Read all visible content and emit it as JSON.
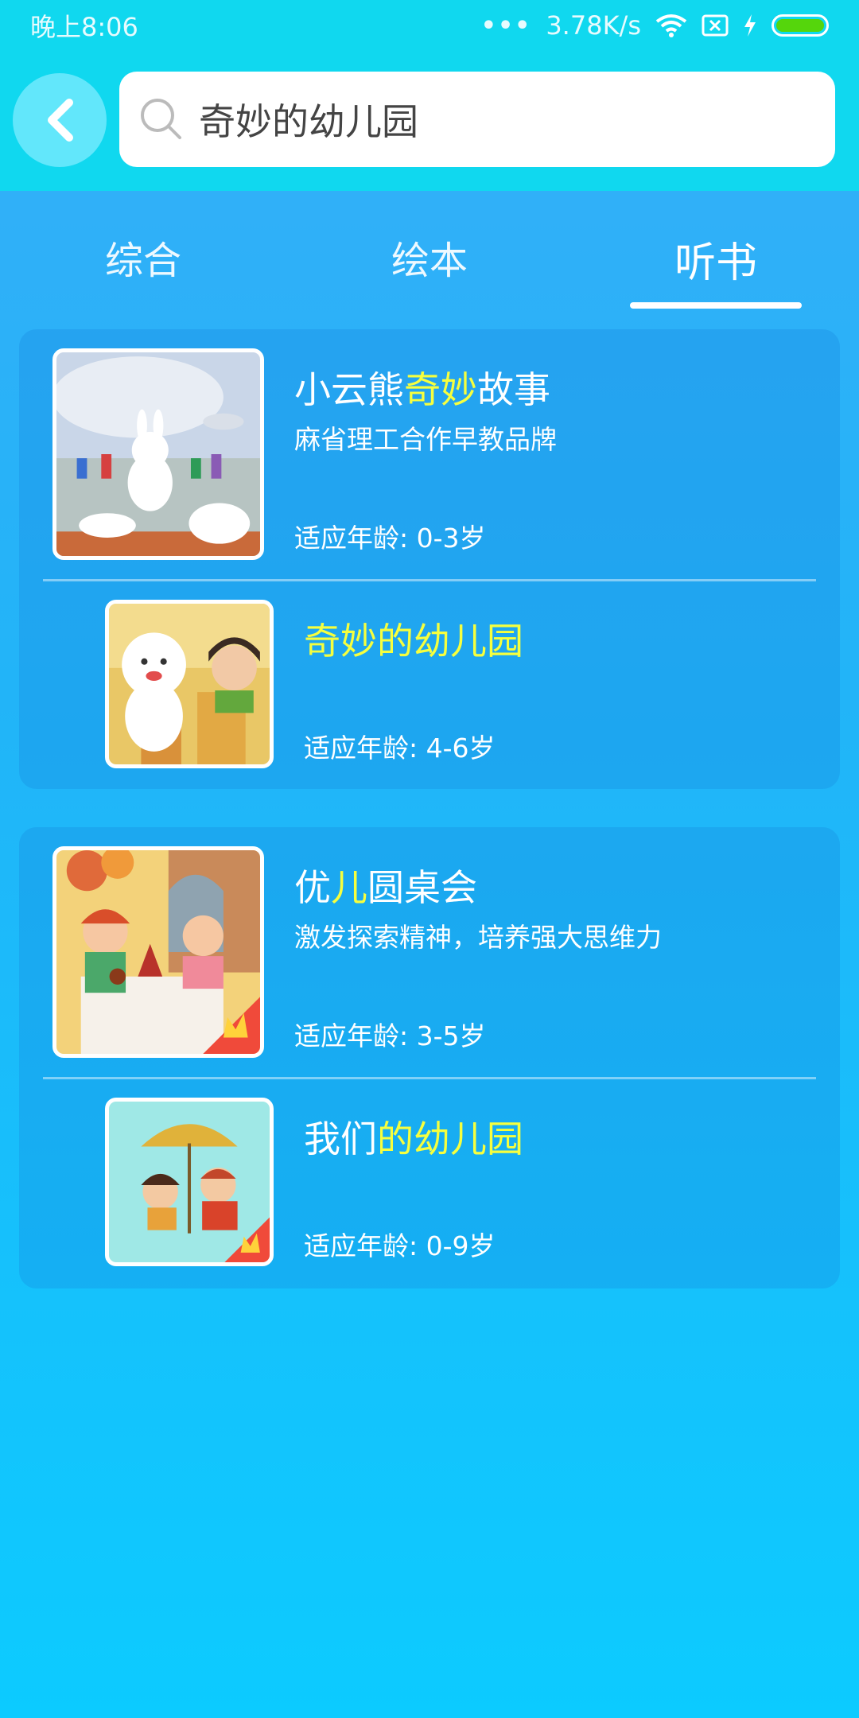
{
  "status_bar": {
    "time": "晚上8:06",
    "dots": "•••",
    "net_speed": "3.78K/s",
    "battery_color": "#55d60c"
  },
  "search": {
    "value": "奇妙的幼儿园",
    "placeholder": ""
  },
  "tabs": [
    {
      "label": "综合",
      "active": false
    },
    {
      "label": "绘本",
      "active": false
    },
    {
      "label": "听书",
      "active": true
    }
  ],
  "highlight_color": "#f6ff3e",
  "results": [
    {
      "album": {
        "title_pre": "小云熊",
        "title_hl": "奇妙",
        "title_post": "故事",
        "desc": "麻省理工合作早教品牌",
        "age": "适应年龄: 0-3岁",
        "vip": false
      },
      "item": {
        "title_pre": "",
        "title_hl": "奇妙的幼儿园",
        "title_post": "",
        "age": "适应年龄: 4-6岁",
        "vip": false
      }
    },
    {
      "album": {
        "title_pre": "优",
        "title_hl": "儿",
        "title_post": "圆桌会",
        "desc": "激发探索精神，培养强大思维力",
        "age": "适应年龄: 3-5岁",
        "vip": true
      },
      "item": {
        "title_pre": "我们",
        "title_hl": "的幼儿园",
        "title_post": "",
        "age": "适应年龄: 0-9岁",
        "vip": true
      }
    }
  ]
}
